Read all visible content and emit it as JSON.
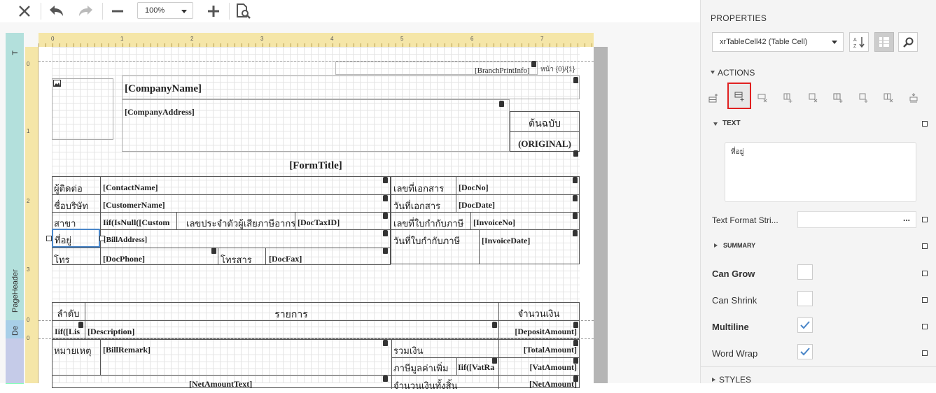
{
  "toolbar": {
    "icons": [
      "close-icon",
      "undo-icon",
      "redo-icon",
      "zoom-out-icon",
      "zoom-in-icon",
      "preview-icon"
    ],
    "zoom_value": "100%"
  },
  "ruler": {
    "h_numbers": [
      "0",
      "1",
      "2",
      "3",
      "4",
      "5",
      "6",
      "7"
    ],
    "v_numbers": [
      "0",
      "1",
      "2",
      "3",
      "0",
      "0"
    ]
  },
  "bands": {
    "top": "T",
    "page_header": "PageHeader",
    "detail": "De"
  },
  "report": {
    "branch_print_info": "[BranchPrintInfo]",
    "page_no": "หน้า {0}/{1}",
    "company_name": "[CompanyName]",
    "company_address": "[CompanyAddress]",
    "original_th": "ต้นฉบับ",
    "original_en": "(ORIGINAL)",
    "form_title": "[FormTitle]",
    "contact_label": "ผู้ติดต่อ",
    "contact_name": "[ContactName]",
    "customer_label": "ชื่อบริษัท",
    "customer_name": "[CustomerName]",
    "branch_label": "สาขา",
    "branch_value": "Iif(IsNull([Custom",
    "taxid_label": "เลขประจำตัวผู้เสียภาษีอากร",
    "taxid_value": "[DocTaxID]",
    "address_label": "ที่อยู่",
    "bill_address": "[BillAddress]",
    "phone_label": "โทร",
    "phone_value": "[DocPhone]",
    "fax_label": "โทรสาร",
    "fax_value": "[DocFax]",
    "docno_label": "เลขที่เอกสาร",
    "docno_value": "[DocNo]",
    "docdate_label": "วันที่เอกสาร",
    "docdate_value": "[DocDate]",
    "invoiceno_label": "เลขที่ใบกำกับภาษี",
    "invoiceno_value": "[InvoiceNo]",
    "invoicedate_label": "วันที่ใบกำกับภาษี",
    "invoicedate_value": "[InvoiceDate]",
    "col_no": "ลำดับ",
    "col_items": "รายการ",
    "col_amount": "จำนวนเงิน",
    "detail_no": "Iif([Lis",
    "detail_desc": "[Description]",
    "detail_amount": "[DepositAmount]",
    "remark_label": "หมายเหตุ",
    "remark_value": "[BillRemark]",
    "total_label": "รวมเงิน",
    "total_value": "[TotalAmount]",
    "vat_label": "ภาษีมูลค่าเพิ่ม",
    "vat_rate": "Iif([VatRa",
    "vat_value": "[VatAmount]",
    "cut_text_1": "[NetAmountText]",
    "cut_text_2": "จำนวนเงินทั้งสิ้น",
    "cut_text_3": "[NetAmount]"
  },
  "panel": {
    "title": "PROPERTIES",
    "object_selector": "xrTableCell42 (Table Cell)",
    "actions_header": "ACTIONS",
    "actions": [
      "insert-row-above-icon",
      "insert-row-below-icon",
      "delete-row-icon",
      "insert-column-left-icon",
      "delete-column-icon",
      "insert-column-right-icon",
      "insert-cell-icon",
      "delete-cell-icon",
      "merge-cells-icon"
    ],
    "text_header": "TEXT",
    "text_value": "ที่อยู่",
    "text_format_label": "Text Format Stri...",
    "text_format_value": "",
    "text_format_button": "...",
    "summary_header": "SUMMARY",
    "can_grow_label": "Can Grow",
    "can_grow": false,
    "can_shrink_label": "Can Shrink",
    "can_shrink": false,
    "multiline_label": "Multiline",
    "multiline": true,
    "word_wrap_label": "Word Wrap",
    "word_wrap": true,
    "styles_header": "STYLES",
    "accent_color": "#4a86c8",
    "highlight_color": "#e02020"
  }
}
